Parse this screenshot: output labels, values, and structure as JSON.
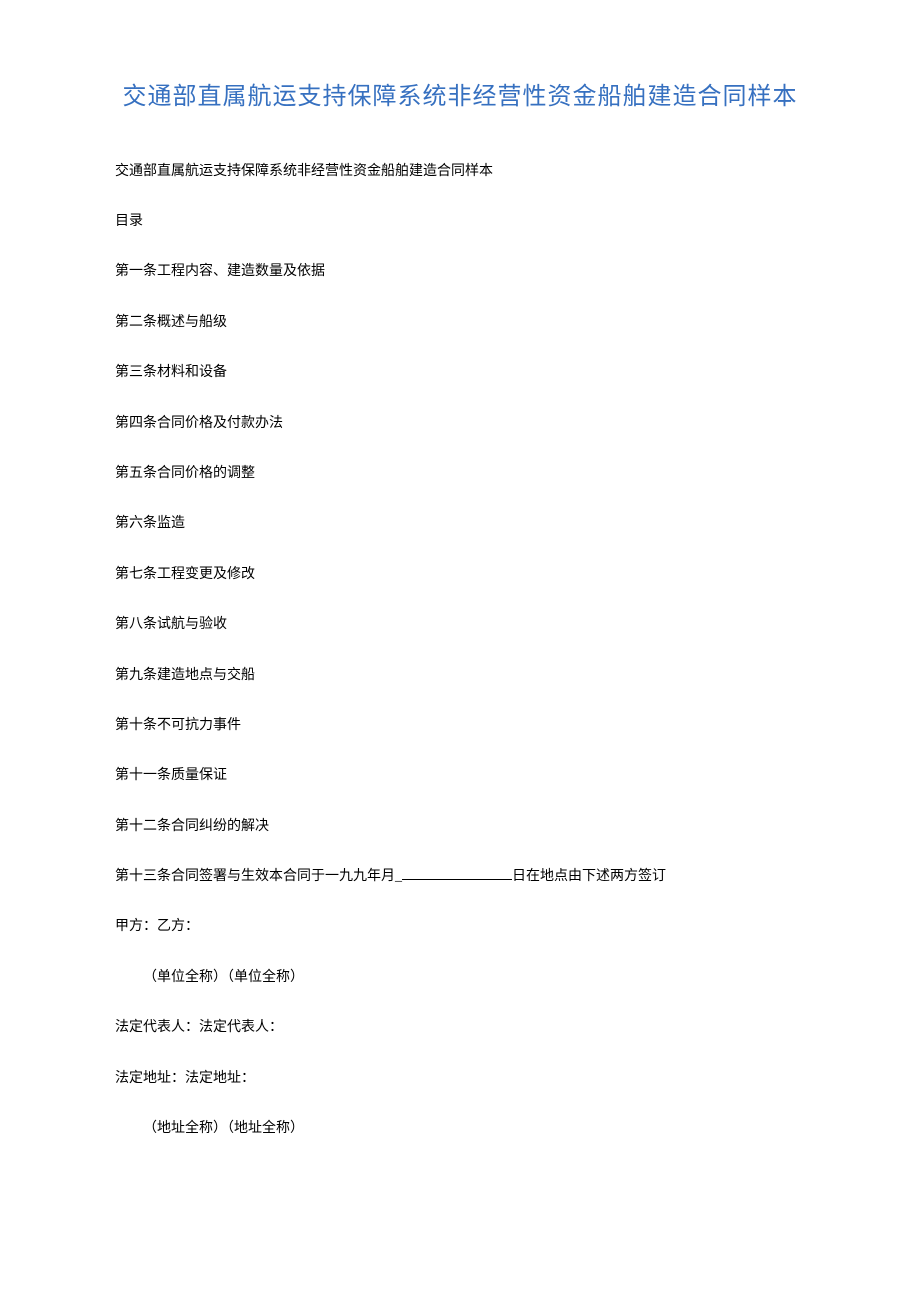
{
  "title": "交通部直属航运支持保障系统非经营性资金船舶建造合同样本",
  "subtitle": "交通部直属航运支持保障系统非经营性资金船舶建造合同样本",
  "toc_label": "目录",
  "articles": [
    "第一条工程内容、建造数量及依据",
    "第二条概述与船级",
    "第三条材料和设备",
    "第四条合同价格及付款办法",
    "第五条合同价格的调整",
    "第六条监造",
    "第七条工程变更及修改",
    "第八条试航与验收",
    "第九条建造地点与交船",
    "第十条不可抗力事件",
    "第十一条质量保证",
    "第十二条合同纠纷的解决"
  ],
  "article13_prefix": "第十三条合同签署与生效本合同于一九九年月_",
  "article13_suffix": "日在地点由下述两方签订",
  "parties": "甲方：乙方：",
  "unit_names": "（单位全称）（单位全称）",
  "legal_reps": "法定代表人：法定代表人：",
  "legal_addresses": "法定地址：法定地址：",
  "address_names": "（地址全称）（地址全称）"
}
